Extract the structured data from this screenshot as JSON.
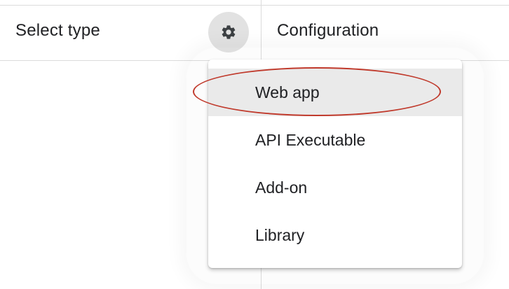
{
  "header": {
    "select_type_label": "Select type",
    "configuration_label": "Configuration"
  },
  "gear_icon": "gear-icon",
  "dropdown": {
    "items": [
      {
        "label": "Web app",
        "selected": true
      },
      {
        "label": "API Executable",
        "selected": false
      },
      {
        "label": "Add-on",
        "selected": false
      },
      {
        "label": "Library",
        "selected": false
      }
    ]
  },
  "colors": {
    "annotation": "#c0392b",
    "selected_background": "#eaeaea",
    "text": "#202124"
  }
}
